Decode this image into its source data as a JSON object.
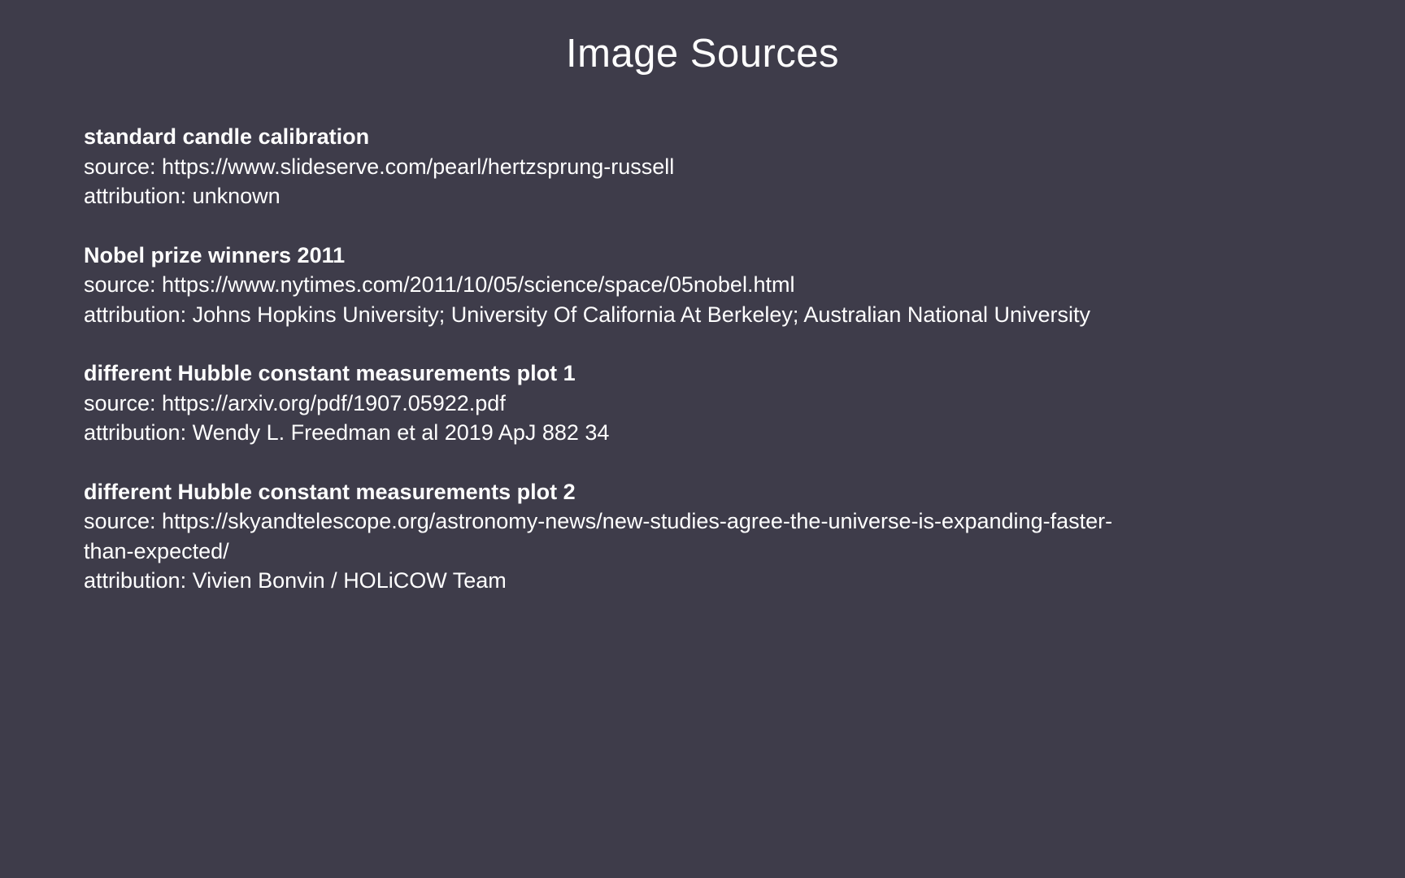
{
  "title": "Image Sources",
  "entries": [
    {
      "title": "standard candle calibration",
      "source": "source: https://www.slideserve.com/pearl/hertzsprung-russell",
      "attribution": "attribution: unknown"
    },
    {
      "title": "Nobel prize winners 2011",
      "source": "source: https://www.nytimes.com/2011/10/05/science/space/05nobel.html",
      "attribution": "attribution: Johns Hopkins University; University Of California At Berkeley; Australian National University"
    },
    {
      "title": "different Hubble constant measurements plot 1",
      "source": "source: https://arxiv.org/pdf/1907.05922.pdf",
      "attribution": "attribution: Wendy L. Freedman et al 2019 ApJ 882 34"
    },
    {
      "title": "different Hubble constant measurements plot 2",
      "source": "source: https://skyandtelescope.org/astronomy-news/new-studies-agree-the-universe-is-expanding-faster-",
      "source_cont": "than-expected/",
      "attribution": "attribution: Vivien Bonvin / HOLiCOW Team"
    }
  ]
}
